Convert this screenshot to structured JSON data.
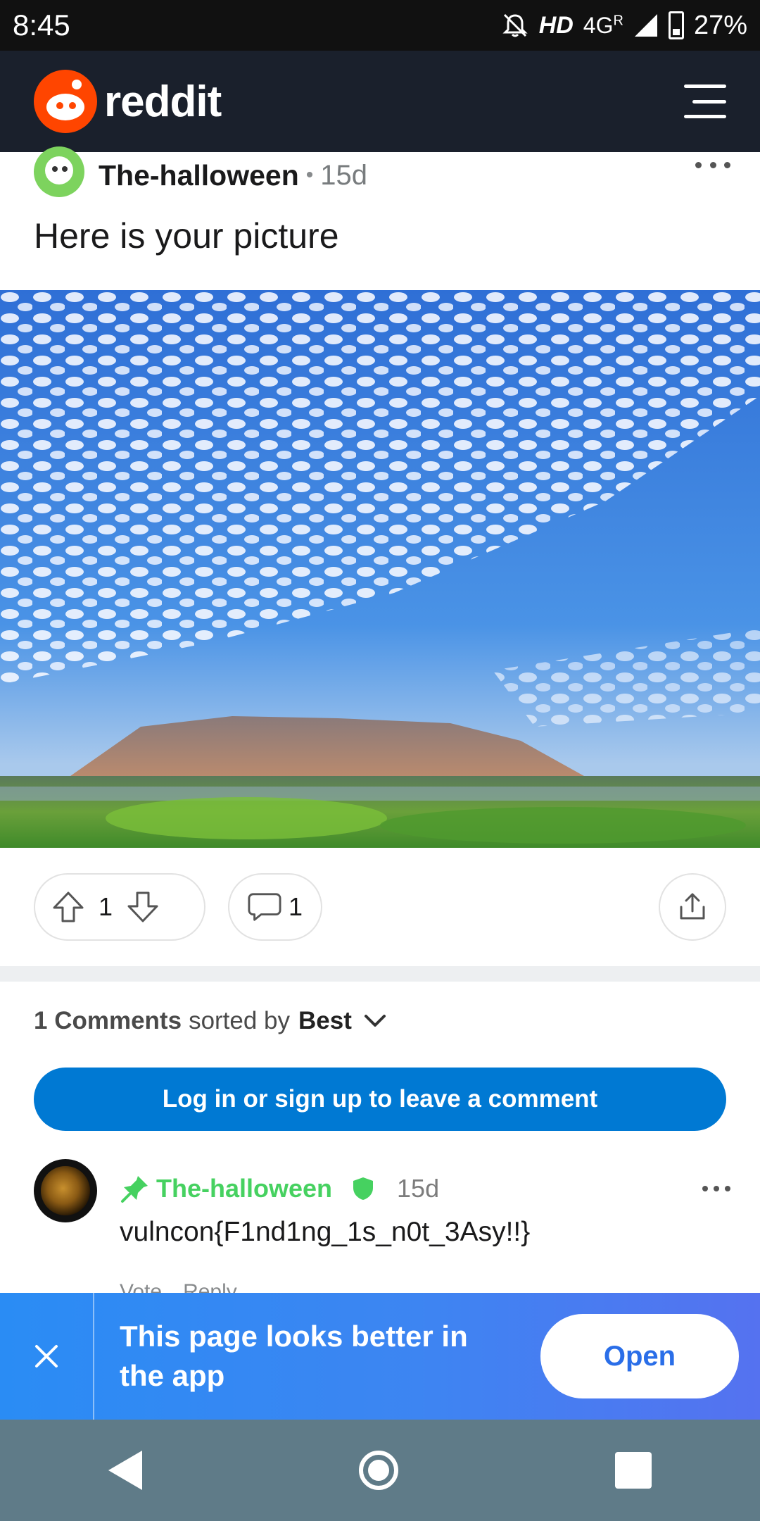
{
  "status_bar": {
    "time": "8:45",
    "network_hd": "HD",
    "network_type": "4G",
    "roaming": "R",
    "battery": "27%"
  },
  "header": {
    "logo_text": "reddit"
  },
  "post": {
    "author": "The-halloween",
    "separator": "•",
    "age": "15d",
    "title": "Here is your picture",
    "upvotes": "1",
    "comments": "1"
  },
  "comments_section": {
    "count_label": "1 Comments",
    "sorted_by": "sorted by",
    "sort_value": "Best",
    "login_prompt": "Log in or sign up to leave a comment"
  },
  "comment": {
    "author": "The-halloween",
    "age": "15d",
    "text": "vulncon{F1nd1ng_1s_n0t_3Asy!!}",
    "vote_label": "Vote",
    "reply_label": "Reply"
  },
  "app_banner": {
    "message": "This page looks better in the app",
    "open_label": "Open"
  },
  "colors": {
    "brand_orange": "#ff4500",
    "header_bg": "#1a202c",
    "login_blue": "#0079d3",
    "mod_green": "#46d160",
    "banner_start": "#2a8cf4",
    "banner_end": "#5572f0"
  },
  "icons": [
    "mute-icon",
    "signal-icon",
    "battery-icon",
    "reddit-logo-icon",
    "menu-icon",
    "more-icon",
    "upvote-icon",
    "downvote-icon",
    "comment-icon",
    "share-icon",
    "chevron-down-icon",
    "pin-icon",
    "shield-icon",
    "close-icon",
    "back-icon",
    "home-icon",
    "recents-icon"
  ]
}
